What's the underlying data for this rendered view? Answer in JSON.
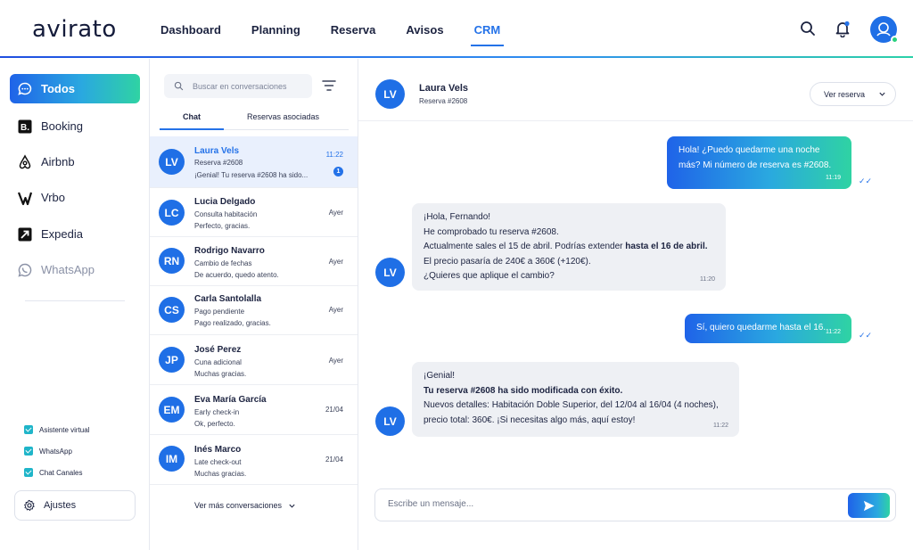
{
  "brand": {
    "logo": "avirato"
  },
  "nav": {
    "items": [
      "Dashboard",
      "Planning",
      "Reserva",
      "Avisos",
      "CRM"
    ],
    "active": "CRM"
  },
  "sidebar": {
    "channels": [
      {
        "label": "Todos",
        "icon": "chat-bubble-icon",
        "active": true
      },
      {
        "label": "Booking",
        "icon": "booking-icon"
      },
      {
        "label": "Airbnb",
        "icon": "airbnb-icon"
      },
      {
        "label": "Vrbo",
        "icon": "vrbo-icon"
      },
      {
        "label": "Expedia",
        "icon": "expedia-icon"
      },
      {
        "label": "WhatsApp",
        "icon": "whatsapp-icon",
        "muted": true
      }
    ],
    "toggles": [
      {
        "label": "Asistente virtual",
        "checked": true
      },
      {
        "label": "WhatsApp",
        "checked": true
      },
      {
        "label": "Chat Canales",
        "checked": true
      }
    ],
    "settings_label": "Ajustes"
  },
  "conversations": {
    "search_placeholder": "Buscar en conversaciones",
    "tabs": [
      "Chat",
      "Reservas asociadas"
    ],
    "items": [
      {
        "initials": "LV",
        "name": "Laura Vels",
        "line1": "Reserva #2608",
        "line2": "¡Genial! Tu reserva #2608 ha sido...",
        "time": "11:22",
        "unread": "1",
        "active": true
      },
      {
        "initials": "LC",
        "name": "Lucia Delgado",
        "line1": "Consulta habitación",
        "line2": "Perfecto, gracias.",
        "time": "Ayer"
      },
      {
        "initials": "RN",
        "name": "Rodrigo Navarro",
        "line1": "Cambio de fechas",
        "line2": "De acuerdo, quedo atento.",
        "time": "Ayer"
      },
      {
        "initials": "CS",
        "name": "Carla Santolalla",
        "line1": "Pago pendiente",
        "line2": "Pago realizado, gracias.",
        "time": "Ayer"
      },
      {
        "initials": "JP",
        "name": "José Perez",
        "line1": "Cuna adicional",
        "line2": "Muchas gracias.",
        "time": "Ayer"
      },
      {
        "initials": "EM",
        "name": "Eva María García",
        "line1": "Early check-in",
        "line2": "Ok, perfecto.",
        "time": "21/04"
      },
      {
        "initials": "IM",
        "name": "Inés Marco",
        "line1": "Late check-out",
        "line2": "Muchas gracias.",
        "time": "21/04"
      }
    ],
    "more_label": "Ver más conversaciones"
  },
  "chat": {
    "contact_initials": "LV",
    "contact_name": "Laura Vels",
    "contact_sub": "Reserva #2608",
    "view_booking_label": "Ver reserva",
    "messages": {
      "m1": {
        "lines": [
          "Hola! ¿Puedo quedarme una noche",
          "más? Mi número de reserva es #2608."
        ],
        "time": "11:19"
      },
      "m2": {
        "lines": [
          "¡Hola, Fernando!",
          "He comprobado tu reserva #2608.",
          "Actualmente sales el 15 de abril. Podrías extender ",
          "hasta el 16 de abril.",
          "El precio pasaría de 240€ a 360€ (+120€).",
          "¿Quieres que aplique el cambio?"
        ],
        "time": "11:20"
      },
      "m3": {
        "lines": [
          "Sí, quiero quedarme hasta el 16."
        ],
        "time": "11:22"
      },
      "m4": {
        "lines": [
          "¡Genial!",
          "Tu reserva #2608 ha sido modificada con éxito.",
          "Nuevos detalles: Habitación Doble Superior, del 12/04 al 16/04 (4 noches),",
          "precio total: 360€. ¡Si necesitas algo más, aquí estoy!"
        ],
        "time": "11:22"
      }
    },
    "composer_placeholder": "Escribe un mensaje..."
  }
}
